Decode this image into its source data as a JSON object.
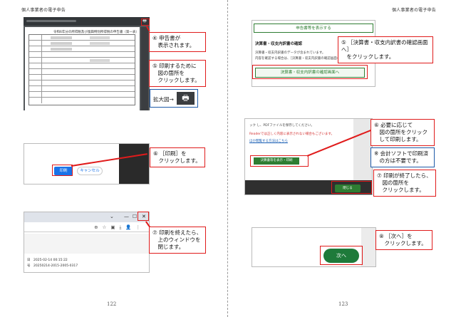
{
  "header": {
    "left_title": "個人事業者の電子申告",
    "right_title": "個人事業者の電子申告"
  },
  "pages": {
    "left_number": "122",
    "right_number": "123"
  },
  "left": {
    "pdf_title": "令和6年分の所得税及び復興特別所得税の申告書（第一表）",
    "callout_4": "④ 申告書が\n　表示されます。",
    "callout_5": "⑤ 印刷するために\n　図の箇所を\n　クリックします。",
    "zoom_label": "拡大図→",
    "zoom_icon": "printer-icon",
    "callout_6": "⑥ ［印刷］を\n　クリックします。",
    "print_button": "印刷",
    "cancel_button": "キャンセル",
    "callout_7": "⑦ 印刷を終えたら、\n　上のウィンドウを\n　閉じます。",
    "close_glyph": "✕",
    "browser_lines": [
      "日　2025-02-14 00:15:22",
      "号　20250214-2015-2005-0317"
    ]
  },
  "right": {
    "top_button": "申告書等を表示する",
    "kessan_heading": "決算書・収支内訳書の確認",
    "kessan_line1": "決算書・収支内訳書のデータが含まれています。",
    "kessan_line2": "内容を確認する場合は、［決算書・収支内訳書の確認画面へ］ボタンを押",
    "kessan_button": "決算書・収支内訳書の確認画面へ",
    "callout_5": "⑤ ［決算書・収支内訳書の確認画面へ］\n　をクリックします。",
    "report_lines": [
      "ック し、PDFファイルを保存してください。",
      "Readerでは正しく内容に表示されない場合もございます。",
      "ほか閲覧する方法はこちら"
    ],
    "report_green": "決算書等を表示・印刷",
    "callout_6": "⑥ 必要に応じて\n　図の箇所をクリック\n　して印刷します。",
    "note": "※ 会計ソフトで印刷済\n　の方は不要です。",
    "close_button": "閉じる",
    "callout_7": "⑦ 印刷が終了したら、\n　図の箇所を\n　クリックします。",
    "next_button": "次へ",
    "callout_8": "⑧ ［次へ］を\n　クリックします。"
  },
  "colors": {
    "callout_border": "#e01b1b",
    "note_border": "#1e5aa8",
    "green": "#2e7d32",
    "print_blue": "#1a73e8"
  }
}
